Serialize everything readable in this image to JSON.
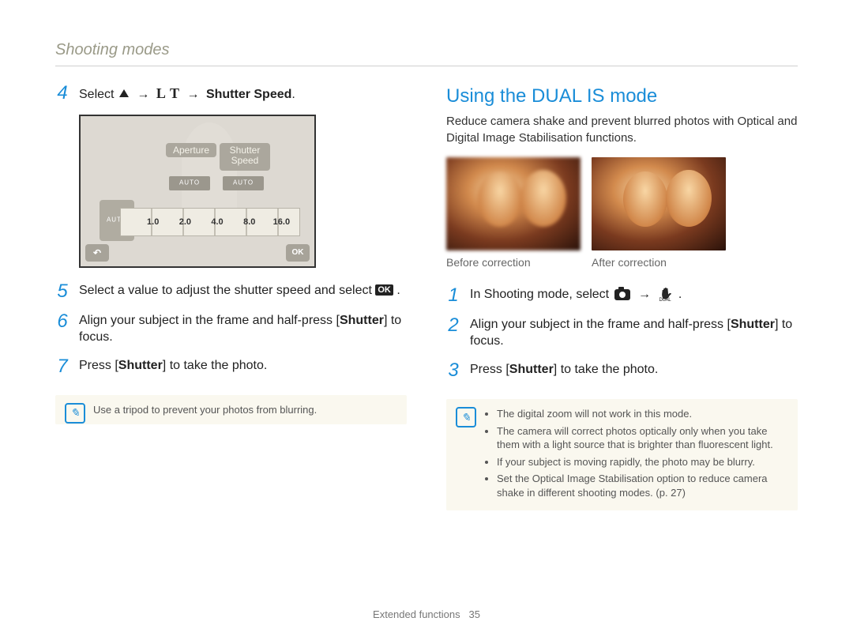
{
  "header": "Shooting modes",
  "left": {
    "step4_prefix": "Select ",
    "step4_suffix": "Shutter Speed",
    "lcd": {
      "aperture": "Aperture",
      "shutter": "Shutter Speed",
      "ticks": [
        "1.0",
        "2.0",
        "4.0",
        "8.0",
        "16.0"
      ],
      "back": "↶",
      "ok": "OK"
    },
    "step5a": "Select a value to adjust the shutter speed and select ",
    "step5_ok": "OK",
    "step5b": ".",
    "step6a": "Align your subject in the frame and half-press [",
    "step6b": "Shutter",
    "step6c": "] to focus.",
    "step7a": "Press [",
    "step7b": "Shutter",
    "step7c": "] to take the photo.",
    "note": "Use a tripod to prevent your photos from blurring."
  },
  "right": {
    "title": "Using the DUAL IS mode",
    "desc": "Reduce camera shake and prevent blurred photos with Optical and Digital Image Stabilisation functions.",
    "before": "Before correction",
    "after": "After correction",
    "step1a": "In Shooting mode, select ",
    "step1b": ".",
    "step2a": "Align your subject in the frame and half-press [",
    "step2b": "Shutter",
    "step2c": "] to focus.",
    "step3a": "Press [",
    "step3b": "Shutter",
    "step3c": "] to take the photo.",
    "notes": [
      "The digital zoom will not work in this mode.",
      "The camera will correct photos optically only when you take them with a light source that is brighter than fluorescent light.",
      "If your subject is moving rapidly, the photo may be blurry.",
      "Set the Optical Image Stabilisation option to reduce camera shake in different shooting modes. (p. 27)"
    ]
  },
  "footer_section": "Extended functions",
  "footer_page": "35",
  "nums": {
    "n1": "1",
    "n2": "2",
    "n3": "3",
    "n4": "4",
    "n5": "5",
    "n6": "6",
    "n7": "7"
  },
  "arrow": "→"
}
